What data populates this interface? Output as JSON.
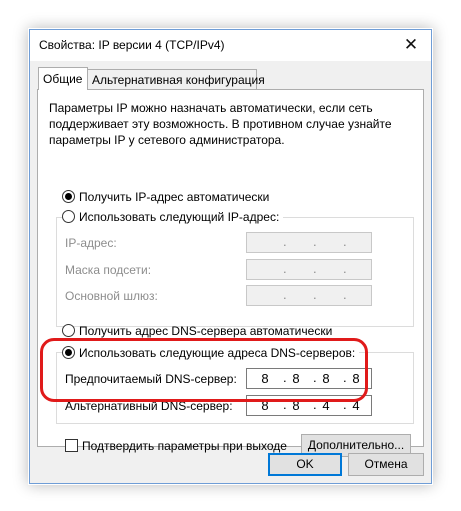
{
  "window": {
    "title": "Свойства: IP версии 4 (TCP/IPv4)",
    "close_glyph": "✕"
  },
  "tabs": [
    {
      "label": "Общие",
      "active": true
    },
    {
      "label": "Альтернативная конфигурация",
      "active": false
    }
  ],
  "description": "Параметры IP можно назначать автоматически, если сеть поддерживает эту возможность. В противном случае узнайте параметры IP у сетевого администратора.",
  "ip_section": {
    "auto_label": "Получить IP-адрес автоматически",
    "manual_label": "Использовать следующий IP-адрес:",
    "selected": "auto",
    "fields": [
      {
        "label": "IP-адрес:",
        "octets": [
          "",
          "",
          "",
          ""
        ],
        "separators": [
          ".",
          ".",
          "."
        ]
      },
      {
        "label": "Маска подсети:",
        "octets": [
          "",
          "",
          "",
          ""
        ],
        "separators": [
          ".",
          ".",
          "."
        ]
      },
      {
        "label": "Основной шлюз:",
        "octets": [
          "",
          "",
          "",
          ""
        ],
        "separators": [
          ".",
          ".",
          "."
        ]
      }
    ]
  },
  "dns_section": {
    "auto_label": "Получить адрес DNS-сервера автоматически",
    "manual_label": "Использовать следующие адреса DNS-серверов:",
    "selected": "manual",
    "fields": [
      {
        "label": "Предпочитаемый DNS-сервер:",
        "octets": [
          "8",
          "8",
          "8",
          "8"
        ],
        "separators": [
          ".",
          ".",
          "."
        ]
      },
      {
        "label": "Альтернативный DNS-сервер:",
        "octets": [
          "8",
          "8",
          "4",
          "4"
        ],
        "separators": [
          ".",
          ".",
          "."
        ]
      }
    ]
  },
  "validate_on_exit": {
    "label": "Подтвердить параметры при выходе",
    "checked": false
  },
  "buttons": {
    "advanced": "Дополнительно...",
    "ok": "OK",
    "cancel": "Отмена"
  },
  "colors": {
    "highlight_ring": "#e01a1a",
    "default_button_border": "#0078d7",
    "window_border": "#6f9dd6"
  }
}
